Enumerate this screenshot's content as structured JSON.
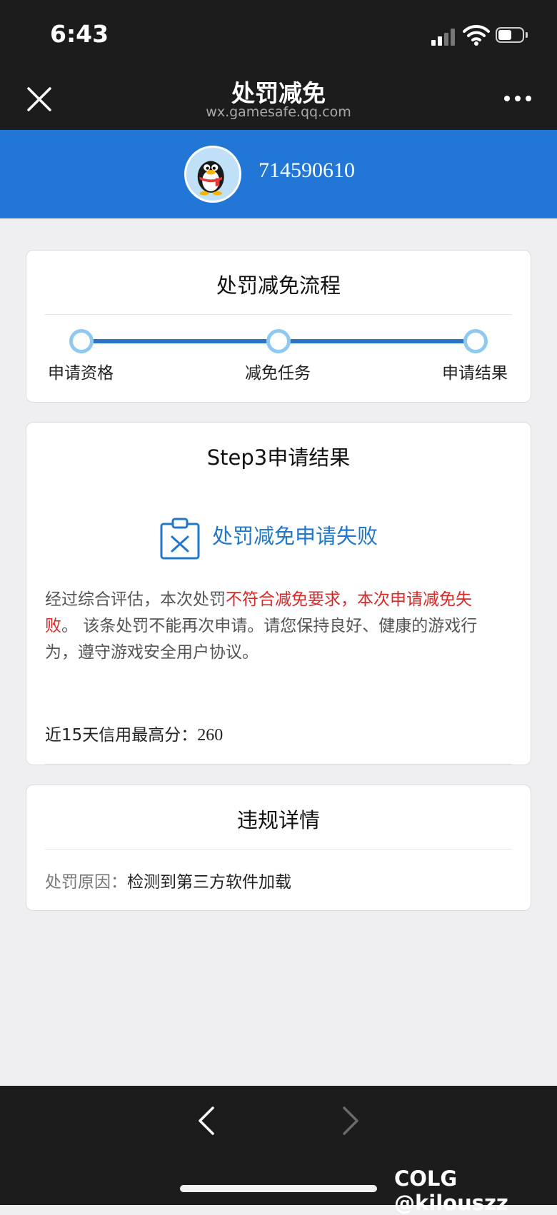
{
  "status_bar": {
    "time": "6:43"
  },
  "nav": {
    "title": "处罚减免",
    "subtitle": "wx.gamesafe.qq.com",
    "close_icon": "close-icon",
    "more_icon": "more-icon"
  },
  "account": {
    "id": "714590610",
    "avatar_icon": "qq-penguin-icon"
  },
  "process_card": {
    "title": "处罚减免流程",
    "steps": [
      {
        "label": "申请资格"
      },
      {
        "label": "减免任务"
      },
      {
        "label": "申请结果"
      }
    ]
  },
  "result_card": {
    "title": "Step3申请结果",
    "status_text": "处罚减免申请失败",
    "desc_prefix": "经过综合评估，本次处罚",
    "desc_highlight": "不符合减免要求，本次申请减免失败",
    "desc_suffix": "。 该条处罚不能再次申请。请您保持良好、健康的游戏行为，遵守游戏安全用户协议。",
    "credit_label": "近15天信用最高分：",
    "credit_value": "260"
  },
  "detail_card": {
    "title": "违规详情",
    "reason_label": "处罚原因：",
    "reason_value": "检测到第三方软件加载"
  },
  "watermark": "COLG @kilouszz",
  "colors": {
    "accent": "#2277d6",
    "error": "#d42a2a",
    "link": "#2277c9"
  }
}
